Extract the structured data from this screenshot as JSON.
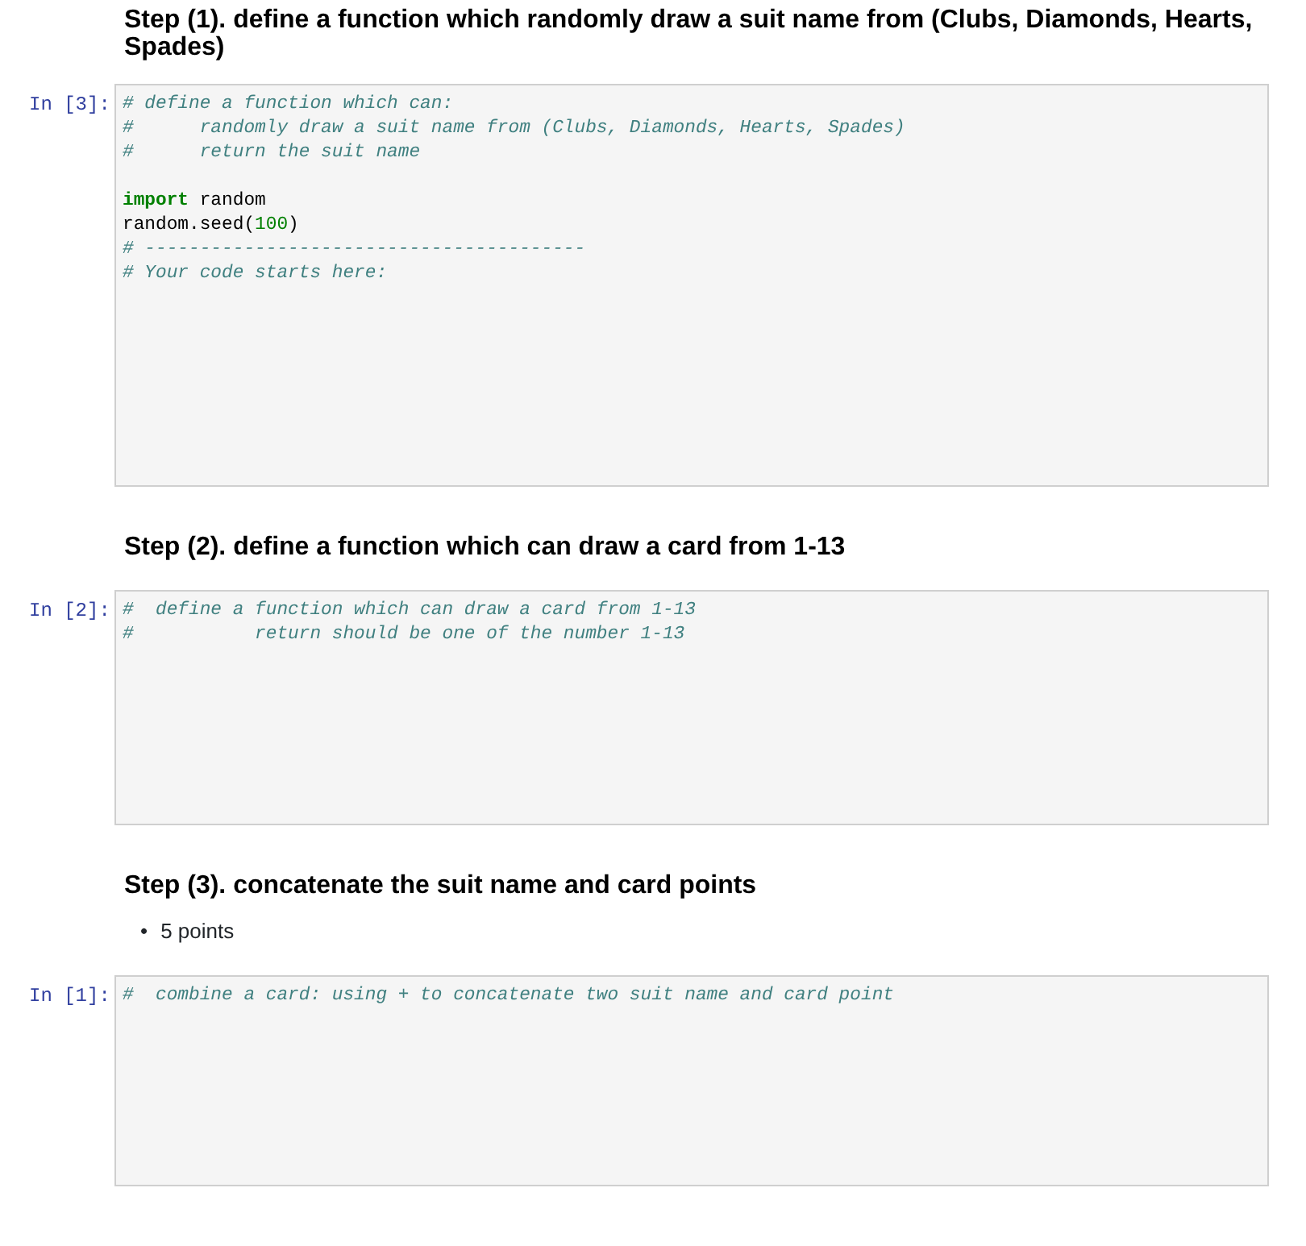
{
  "cells": [
    {
      "kind": "markdown",
      "heading": "Step (1). define a function which randomly draw a suit name from (Clubs, Diamonds, Hearts, Spades)"
    },
    {
      "kind": "code",
      "prompt": "In [3]:",
      "blocks": [
        [
          [
            {
              "kind": "comment",
              "text": "# define a function which can:"
            }
          ],
          [
            {
              "kind": "comment",
              "text": "#      randomly draw a suit name from (Clubs, Diamonds, Hearts, Spades)"
            }
          ],
          [
            {
              "kind": "comment",
              "text": "#      return the suit name"
            }
          ]
        ],
        [
          [
            {
              "kind": "keyword",
              "text": "import"
            },
            {
              "kind": "plain",
              "text": " random"
            }
          ],
          [
            {
              "kind": "plain",
              "text": "random.seed("
            },
            {
              "kind": "number",
              "text": "100"
            },
            {
              "kind": "plain",
              "text": ")"
            }
          ],
          [
            {
              "kind": "comment",
              "text": "# ----------------------------------------"
            }
          ],
          [
            {
              "kind": "comment",
              "text": "# Your code starts here:"
            }
          ]
        ]
      ]
    },
    {
      "kind": "markdown",
      "heading": "Step (2). define a function which can draw a card from 1-13"
    },
    {
      "kind": "code",
      "prompt": "In [2]:",
      "blocks": [
        [
          [
            {
              "kind": "comment",
              "text": "#  define a function which can draw a card from 1-13"
            }
          ],
          [
            {
              "kind": "comment",
              "text": "#           return should be one of the number 1-13"
            }
          ]
        ]
      ]
    },
    {
      "kind": "markdown",
      "heading": "Step (3). concatenate the suit name and card points",
      "bullets": [
        {
          "marker": "•",
          "text": "5 points"
        }
      ]
    },
    {
      "kind": "code",
      "prompt": "In [1]:",
      "blocks": [
        [
          [
            {
              "kind": "comment",
              "text": "#  combine a card: using + to concatenate two suit name and card point"
            }
          ]
        ]
      ]
    }
  ]
}
